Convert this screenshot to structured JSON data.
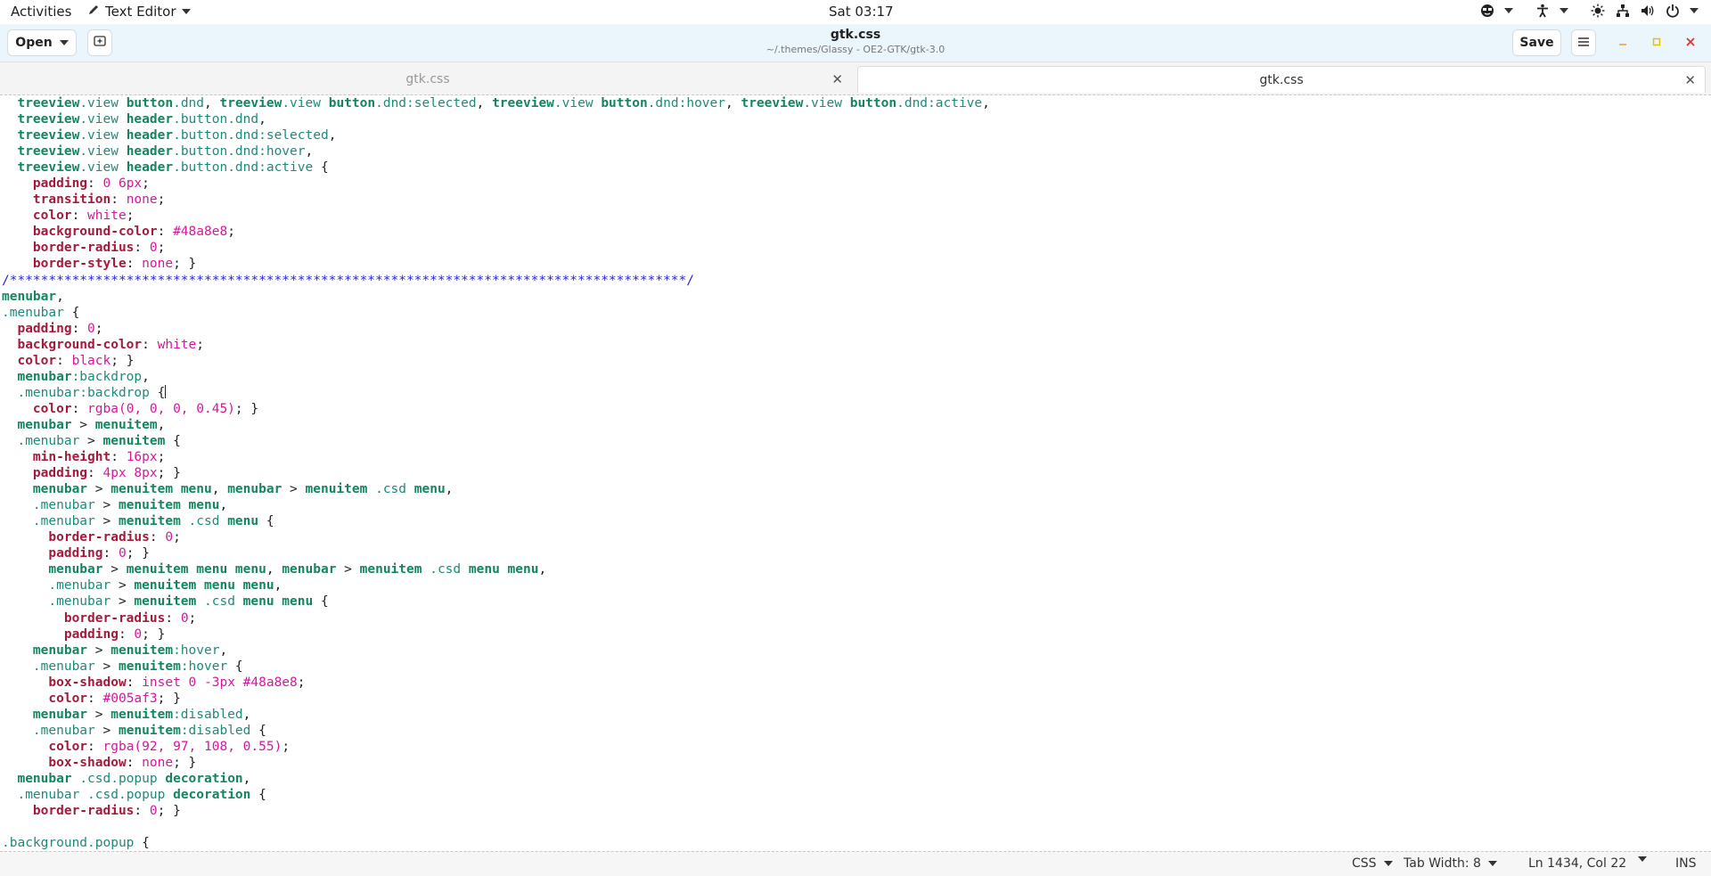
{
  "topbar": {
    "activities": "Activities",
    "app_name": "Text Editor",
    "clock": "Sat 03:17"
  },
  "header": {
    "open_label": "Open",
    "title": "gtk.css",
    "subtitle": "~/.themes/Glassy - OE2-GTK/gtk-3.0",
    "save_label": "Save"
  },
  "tabs": [
    {
      "label": "gtk.css",
      "active": false
    },
    {
      "label": "gtk.css",
      "active": true
    }
  ],
  "editor": {
    "lines": [
      [
        [
          "s",
          "  treeview"
        ],
        [
          "c",
          ".view"
        ],
        [
          "t",
          " "
        ],
        [
          "s",
          "button"
        ],
        [
          "c",
          ".dnd"
        ],
        [
          "t",
          ", "
        ],
        [
          "s",
          "treeview"
        ],
        [
          "c",
          ".view"
        ],
        [
          "t",
          " "
        ],
        [
          "s",
          "button"
        ],
        [
          "c",
          ".dnd:selected"
        ],
        [
          "t",
          ", "
        ],
        [
          "s",
          "treeview"
        ],
        [
          "c",
          ".view"
        ],
        [
          "t",
          " "
        ],
        [
          "s",
          "button"
        ],
        [
          "c",
          ".dnd:hover"
        ],
        [
          "t",
          ", "
        ],
        [
          "s",
          "treeview"
        ],
        [
          "c",
          ".view"
        ],
        [
          "t",
          " "
        ],
        [
          "s",
          "button"
        ],
        [
          "c",
          ".dnd:active"
        ],
        [
          "t",
          ","
        ]
      ],
      [
        [
          "s",
          "  treeview"
        ],
        [
          "c",
          ".view"
        ],
        [
          "t",
          " "
        ],
        [
          "s",
          "header"
        ],
        [
          "c",
          ".button.dnd"
        ],
        [
          "t",
          ","
        ]
      ],
      [
        [
          "s",
          "  treeview"
        ],
        [
          "c",
          ".view"
        ],
        [
          "t",
          " "
        ],
        [
          "s",
          "header"
        ],
        [
          "c",
          ".button.dnd:selected"
        ],
        [
          "t",
          ","
        ]
      ],
      [
        [
          "s",
          "  treeview"
        ],
        [
          "c",
          ".view"
        ],
        [
          "t",
          " "
        ],
        [
          "s",
          "header"
        ],
        [
          "c",
          ".button.dnd:hover"
        ],
        [
          "t",
          ","
        ]
      ],
      [
        [
          "s",
          "  treeview"
        ],
        [
          "c",
          ".view"
        ],
        [
          "t",
          " "
        ],
        [
          "s",
          "header"
        ],
        [
          "c",
          ".button.dnd:active"
        ],
        [
          "t",
          " {"
        ]
      ],
      [
        [
          "t",
          "    "
        ],
        [
          "p",
          "padding"
        ],
        [
          "t",
          ": "
        ],
        [
          "v",
          "0 6px"
        ],
        [
          "t",
          ";"
        ]
      ],
      [
        [
          "t",
          "    "
        ],
        [
          "p",
          "transition"
        ],
        [
          "t",
          ": "
        ],
        [
          "v",
          "none"
        ],
        [
          "t",
          ";"
        ]
      ],
      [
        [
          "t",
          "    "
        ],
        [
          "p",
          "color"
        ],
        [
          "t",
          ": "
        ],
        [
          "v",
          "white"
        ],
        [
          "t",
          ";"
        ]
      ],
      [
        [
          "t",
          "    "
        ],
        [
          "p",
          "background-color"
        ],
        [
          "t",
          ": "
        ],
        [
          "v",
          "#48a8e8"
        ],
        [
          "t",
          ";"
        ]
      ],
      [
        [
          "t",
          "    "
        ],
        [
          "p",
          "border-radius"
        ],
        [
          "t",
          ": "
        ],
        [
          "v",
          "0"
        ],
        [
          "t",
          ";"
        ]
      ],
      [
        [
          "t",
          "    "
        ],
        [
          "p",
          "border-style"
        ],
        [
          "t",
          ": "
        ],
        [
          "v",
          "none"
        ],
        [
          "t",
          "; }"
        ]
      ],
      [
        [
          "cm",
          "/***************************************************************************************/"
        ]
      ],
      [
        [
          "s",
          "menubar"
        ],
        [
          "t",
          ","
        ]
      ],
      [
        [
          "c",
          ".menubar"
        ],
        [
          "t",
          " {"
        ]
      ],
      [
        [
          "t",
          "  "
        ],
        [
          "p",
          "padding"
        ],
        [
          "t",
          ": "
        ],
        [
          "v",
          "0"
        ],
        [
          "t",
          ";"
        ]
      ],
      [
        [
          "t",
          "  "
        ],
        [
          "p",
          "background-color"
        ],
        [
          "t",
          ": "
        ],
        [
          "v",
          "white"
        ],
        [
          "t",
          ";"
        ]
      ],
      [
        [
          "t",
          "  "
        ],
        [
          "p",
          "color"
        ],
        [
          "t",
          ": "
        ],
        [
          "v",
          "black"
        ],
        [
          "t",
          "; }"
        ]
      ],
      [
        [
          "s",
          "  menubar"
        ],
        [
          "c",
          ":backdrop"
        ],
        [
          "t",
          ","
        ]
      ],
      [
        [
          "c",
          "  .menubar:backdrop"
        ],
        [
          "t",
          " {"
        ],
        [
          "caret",
          ""
        ]
      ],
      [
        [
          "t",
          "    "
        ],
        [
          "p",
          "color"
        ],
        [
          "t",
          ": "
        ],
        [
          "v",
          "rgba(0, 0, 0, 0.45)"
        ],
        [
          "t",
          "; }"
        ]
      ],
      [
        [
          "s",
          "  menubar"
        ],
        [
          "t",
          " > "
        ],
        [
          "s",
          "menuitem"
        ],
        [
          "t",
          ","
        ]
      ],
      [
        [
          "c",
          "  .menubar"
        ],
        [
          "t",
          " > "
        ],
        [
          "s",
          "menuitem"
        ],
        [
          "t",
          " {"
        ]
      ],
      [
        [
          "t",
          "    "
        ],
        [
          "p",
          "min-height"
        ],
        [
          "t",
          ": "
        ],
        [
          "v",
          "16px"
        ],
        [
          "t",
          ";"
        ]
      ],
      [
        [
          "t",
          "    "
        ],
        [
          "p",
          "padding"
        ],
        [
          "t",
          ": "
        ],
        [
          "v",
          "4px 8px"
        ],
        [
          "t",
          "; }"
        ]
      ],
      [
        [
          "s",
          "    menubar"
        ],
        [
          "t",
          " > "
        ],
        [
          "s",
          "menuitem"
        ],
        [
          "t",
          " "
        ],
        [
          "s",
          "menu"
        ],
        [
          "t",
          ", "
        ],
        [
          "s",
          "menubar"
        ],
        [
          "t",
          " > "
        ],
        [
          "s",
          "menuitem"
        ],
        [
          "t",
          " "
        ],
        [
          "c",
          ".csd"
        ],
        [
          "t",
          " "
        ],
        [
          "s",
          "menu"
        ],
        [
          "t",
          ","
        ]
      ],
      [
        [
          "c",
          "    .menubar"
        ],
        [
          "t",
          " > "
        ],
        [
          "s",
          "menuitem"
        ],
        [
          "t",
          " "
        ],
        [
          "s",
          "menu"
        ],
        [
          "t",
          ","
        ]
      ],
      [
        [
          "c",
          "    .menubar"
        ],
        [
          "t",
          " > "
        ],
        [
          "s",
          "menuitem"
        ],
        [
          "t",
          " "
        ],
        [
          "c",
          ".csd"
        ],
        [
          "t",
          " "
        ],
        [
          "s",
          "menu"
        ],
        [
          "t",
          " {"
        ]
      ],
      [
        [
          "t",
          "      "
        ],
        [
          "p",
          "border-radius"
        ],
        [
          "t",
          ": "
        ],
        [
          "v",
          "0"
        ],
        [
          "t",
          ";"
        ]
      ],
      [
        [
          "t",
          "      "
        ],
        [
          "p",
          "padding"
        ],
        [
          "t",
          ": "
        ],
        [
          "v",
          "0"
        ],
        [
          "t",
          "; }"
        ]
      ],
      [
        [
          "s",
          "      menubar"
        ],
        [
          "t",
          " > "
        ],
        [
          "s",
          "menuitem"
        ],
        [
          "t",
          " "
        ],
        [
          "s",
          "menu menu"
        ],
        [
          "t",
          ", "
        ],
        [
          "s",
          "menubar"
        ],
        [
          "t",
          " > "
        ],
        [
          "s",
          "menuitem"
        ],
        [
          "t",
          " "
        ],
        [
          "c",
          ".csd"
        ],
        [
          "t",
          " "
        ],
        [
          "s",
          "menu menu"
        ],
        [
          "t",
          ","
        ]
      ],
      [
        [
          "c",
          "      .menubar"
        ],
        [
          "t",
          " > "
        ],
        [
          "s",
          "menuitem"
        ],
        [
          "t",
          " "
        ],
        [
          "s",
          "menu menu"
        ],
        [
          "t",
          ","
        ]
      ],
      [
        [
          "c",
          "      .menubar"
        ],
        [
          "t",
          " > "
        ],
        [
          "s",
          "menuitem"
        ],
        [
          "t",
          " "
        ],
        [
          "c",
          ".csd"
        ],
        [
          "t",
          " "
        ],
        [
          "s",
          "menu menu"
        ],
        [
          "t",
          " {"
        ]
      ],
      [
        [
          "t",
          "        "
        ],
        [
          "p",
          "border-radius"
        ],
        [
          "t",
          ": "
        ],
        [
          "v",
          "0"
        ],
        [
          "t",
          ";"
        ]
      ],
      [
        [
          "t",
          "        "
        ],
        [
          "p",
          "padding"
        ],
        [
          "t",
          ": "
        ],
        [
          "v",
          "0"
        ],
        [
          "t",
          "; }"
        ]
      ],
      [
        [
          "s",
          "    menubar"
        ],
        [
          "t",
          " > "
        ],
        [
          "s",
          "menuitem"
        ],
        [
          "c",
          ":hover"
        ],
        [
          "t",
          ","
        ]
      ],
      [
        [
          "c",
          "    .menubar"
        ],
        [
          "t",
          " > "
        ],
        [
          "s",
          "menuitem"
        ],
        [
          "c",
          ":hover"
        ],
        [
          "t",
          " {"
        ]
      ],
      [
        [
          "t",
          "      "
        ],
        [
          "p",
          "box-shadow"
        ],
        [
          "t",
          ": "
        ],
        [
          "v",
          "inset 0 -3px #48a8e8"
        ],
        [
          "t",
          ";"
        ]
      ],
      [
        [
          "t",
          "      "
        ],
        [
          "p",
          "color"
        ],
        [
          "t",
          ": "
        ],
        [
          "v",
          "#005af3"
        ],
        [
          "t",
          "; }"
        ]
      ],
      [
        [
          "s",
          "    menubar"
        ],
        [
          "t",
          " > "
        ],
        [
          "s",
          "menuitem"
        ],
        [
          "c",
          ":disabled"
        ],
        [
          "t",
          ","
        ]
      ],
      [
        [
          "c",
          "    .menubar"
        ],
        [
          "t",
          " > "
        ],
        [
          "s",
          "menuitem"
        ],
        [
          "c",
          ":disabled"
        ],
        [
          "t",
          " {"
        ]
      ],
      [
        [
          "t",
          "      "
        ],
        [
          "p",
          "color"
        ],
        [
          "t",
          ": "
        ],
        [
          "v",
          "rgba(92, 97, 108, 0.55)"
        ],
        [
          "t",
          ";"
        ]
      ],
      [
        [
          "t",
          "      "
        ],
        [
          "p",
          "box-shadow"
        ],
        [
          "t",
          ": "
        ],
        [
          "v",
          "none"
        ],
        [
          "t",
          "; }"
        ]
      ],
      [
        [
          "s",
          "  menubar"
        ],
        [
          "t",
          " "
        ],
        [
          "c",
          ".csd.popup"
        ],
        [
          "t",
          " "
        ],
        [
          "s",
          "decoration"
        ],
        [
          "t",
          ","
        ]
      ],
      [
        [
          "c",
          "  .menubar"
        ],
        [
          "t",
          " "
        ],
        [
          "c",
          ".csd.popup"
        ],
        [
          "t",
          " "
        ],
        [
          "s",
          "decoration"
        ],
        [
          "t",
          " {"
        ]
      ],
      [
        [
          "t",
          "    "
        ],
        [
          "p",
          "border-radius"
        ],
        [
          "t",
          ": "
        ],
        [
          "v",
          "0"
        ],
        [
          "t",
          "; }"
        ]
      ],
      [
        [
          "t",
          ""
        ]
      ],
      [
        [
          "c",
          ".background.popup"
        ],
        [
          "t",
          " {"
        ]
      ]
    ]
  },
  "status": {
    "language": "CSS",
    "tab_width": "Tab Width: 8",
    "position": "Ln 1434, Col 22",
    "mode": "INS"
  }
}
